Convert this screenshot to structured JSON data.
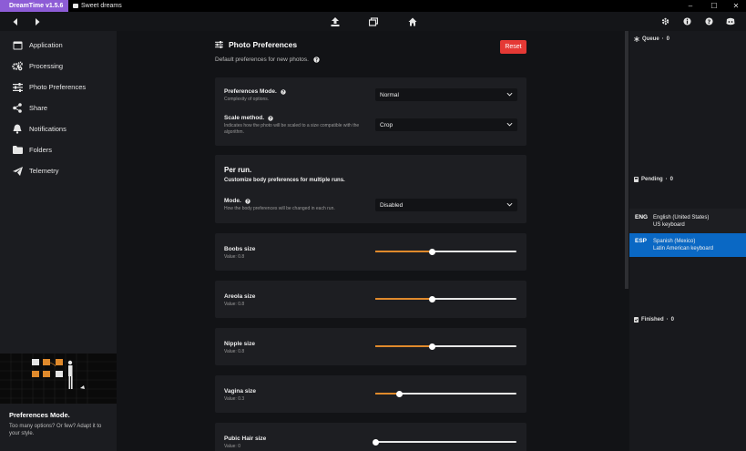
{
  "titlebar": {
    "app_name": "DreamTime v1.5.6",
    "doc_title": "Sweet dreams"
  },
  "window_controls": [
    "–",
    "☐",
    "✕"
  ],
  "sidebar": {
    "items": [
      {
        "label": "Application",
        "icon": "window-icon"
      },
      {
        "label": "Processing",
        "icon": "gears-icon"
      },
      {
        "label": "Photo Preferences",
        "icon": "sliders-icon"
      },
      {
        "label": "Share",
        "icon": "share-icon"
      },
      {
        "label": "Notifications",
        "icon": "bell-icon"
      },
      {
        "label": "Folders",
        "icon": "folder-icon"
      },
      {
        "label": "Telemetry",
        "icon": "paper-plane-icon"
      }
    ],
    "tip": {
      "title": "Preferences Mode.",
      "text": "Too many options? Or few? Adapt it to your style."
    }
  },
  "main": {
    "title": "Photo Preferences",
    "subtitle": "Default preferences for new photos.",
    "reset_label": "Reset",
    "general": {
      "mode_label": "Preferences Mode.",
      "mode_desc": "Complexity of options.",
      "mode_value": "Normal",
      "scale_label": "Scale method.",
      "scale_desc": "Indicates how the photo will be scaled to a size compatible with the algorithm.",
      "scale_value": "Crop"
    },
    "per_run": {
      "title": "Per run.",
      "subtitle": "Customize body preferences for multiple runs.",
      "mode_label": "Mode.",
      "mode_desc": "How the body preferences will be changed in each run.",
      "mode_value": "Disabled"
    },
    "sliders": [
      {
        "label": "Boobs size",
        "value_text": "Value: 0.8",
        "fraction": 0.4
      },
      {
        "label": "Areola size",
        "value_text": "Value: 0.8",
        "fraction": 0.4
      },
      {
        "label": "Nipple size",
        "value_text": "Value: 0.8",
        "fraction": 0.4
      },
      {
        "label": "Vagina size",
        "value_text": "Value: 0.3",
        "fraction": 0.17
      },
      {
        "label": "Pubic Hair size",
        "value_text": "Value: 0",
        "fraction": 0.0
      }
    ]
  },
  "queue": {
    "queue_label": "Queue",
    "queue_count": "0",
    "pending_label": "Pending",
    "pending_count": "0",
    "finished_label": "Finished",
    "finished_count": "0"
  },
  "languages": [
    {
      "code": "ENG",
      "name": "English (United States)",
      "layout": "US keyboard",
      "active": false
    },
    {
      "code": "ESP",
      "name": "Spanish (Mexico)",
      "layout": "Latin American keyboard",
      "active": true
    }
  ],
  "colors": {
    "accent": "#e08a2c",
    "danger": "#e53935",
    "brand": "#8d5cd6",
    "selection": "#0a68c4"
  }
}
